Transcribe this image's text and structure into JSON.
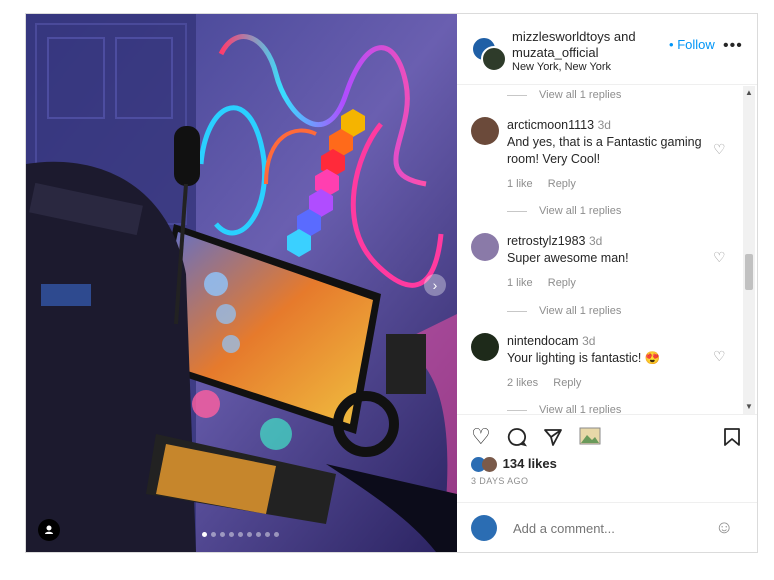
{
  "header": {
    "user1": "mizzlesworldtoys",
    "and": "and",
    "user2": "muzata_official",
    "location": "New York, New York",
    "follow_dot": "•",
    "follow": "Follow",
    "more": "•••"
  },
  "comments": [
    {
      "view_replies": "View all 1 replies"
    },
    {
      "user": "arcticmoon1113",
      "time": "3d",
      "text": "And yes, that is a Fantastic gaming room! Very Cool!",
      "likes": "1 like",
      "reply": "Reply",
      "view_replies": "View all 1 replies"
    },
    {
      "user": "retrostylz1983",
      "time": "3d",
      "text": "Super awesome man!",
      "likes": "1 like",
      "reply": "Reply",
      "view_replies": "View all 1 replies"
    },
    {
      "user": "nintendocam",
      "time": "3d",
      "text": "Your lighting is fantastic! 😍",
      "likes": "2 likes",
      "reply": "Reply",
      "view_replies": "View all 1 replies"
    }
  ],
  "icons": {
    "heart": "♡",
    "like": "♡",
    "comment": "◯",
    "share": "➢",
    "save": "⌑",
    "emoji": "☺",
    "next": "›",
    "scroll_up": "▲",
    "scroll_down": "▼"
  },
  "likes": "134 likes",
  "date": "3 DAYS AGO",
  "add_comment_placeholder": "Add a comment...",
  "colors": {
    "accent": "#0095f6"
  },
  "carousel": {
    "current": 1,
    "total": 9
  }
}
